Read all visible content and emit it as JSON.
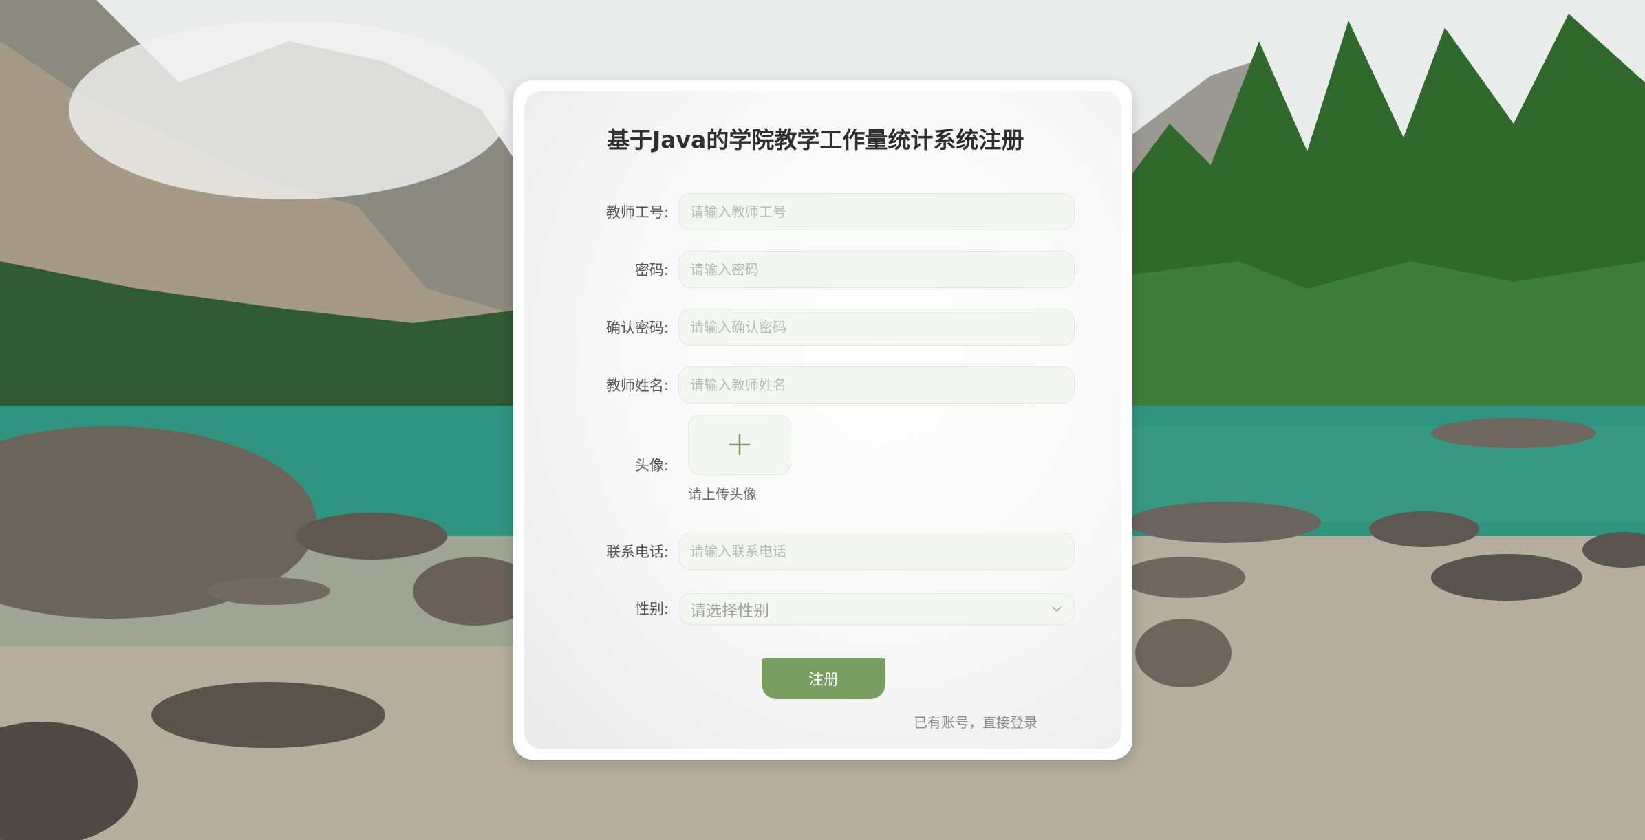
{
  "form": {
    "title": "基于Java的学院教学工作量统计系统注册",
    "teacher_id": {
      "label": "教师工号:",
      "placeholder": "请输入教师工号"
    },
    "password": {
      "label": "密码:",
      "placeholder": "请输入密码"
    },
    "confirm_password": {
      "label": "确认密码:",
      "placeholder": "请输入确认密码"
    },
    "teacher_name": {
      "label": "教师姓名:",
      "placeholder": "请输入教师姓名"
    },
    "avatar": {
      "label": "头像:",
      "tip": "请上传头像",
      "icon": "plus-icon"
    },
    "phone": {
      "label": "联系电话:",
      "placeholder": "请输入联系电话"
    },
    "gender": {
      "label": "性别:",
      "placeholder": "请选择性别",
      "icon": "chevron-down-icon"
    },
    "submit_label": "注册",
    "login_link": "已有账号，直接登录"
  },
  "colors": {
    "accent": "#789f60",
    "input_bg": "#f4f6f1",
    "title": "#2f2f2f"
  }
}
